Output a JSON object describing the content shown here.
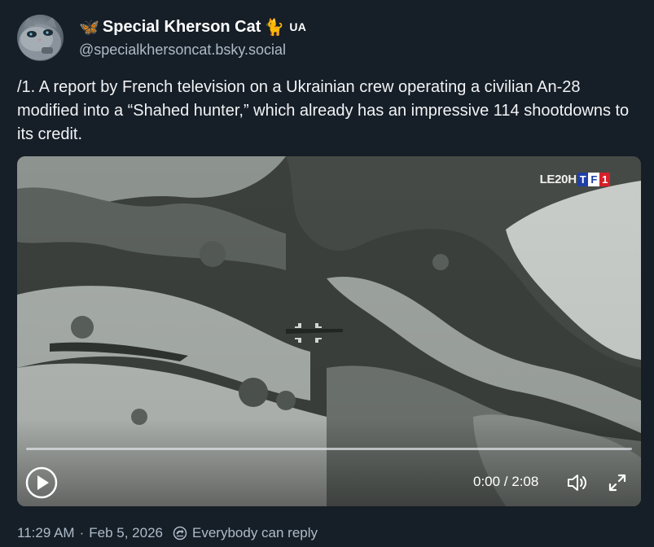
{
  "author": {
    "display_name": "Special Kherson Cat",
    "leading_emoji": "🦋",
    "trailing_emoji": "🐈",
    "flag_label": "UA",
    "handle": "@specialkhersoncat.bsky.social"
  },
  "post": {
    "text": "/1. A report by French television on a Ukrainian crew operating a civilian An-28 modified into a “Shahed hunter,” which already has an impressive 114 shootdowns to its credit."
  },
  "video": {
    "channel_logo": {
      "prefix": "LE20H",
      "letters": [
        "T",
        "F",
        "1"
      ],
      "letter_colors": [
        "#1f3fa6",
        "#ffffff",
        "#d6202b"
      ]
    },
    "time": "0:00 / 2:08",
    "progress": 0,
    "play_icon": "play-icon",
    "volume_icon": "volume-icon",
    "fullscreen_icon": "fullscreen-icon"
  },
  "meta": {
    "time": "11:29 AM",
    "separator": "·",
    "date": "Feb 5, 2026",
    "reply_icon": "reply-settings-icon",
    "reply_setting": "Everybody can reply"
  }
}
